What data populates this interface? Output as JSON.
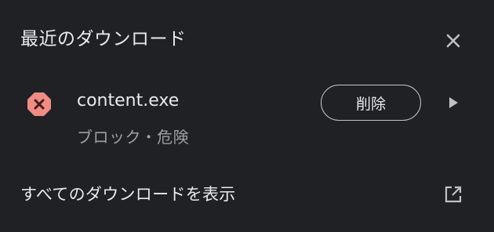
{
  "header": {
    "title": "最近のダウンロード",
    "close_icon": "close-icon"
  },
  "download": {
    "file_name": "content.exe",
    "status": "ブロック・危険",
    "status_icon": "danger-x-icon",
    "status_color": "#f28b82",
    "delete_label": "削除",
    "more_icon": "play-arrow-icon"
  },
  "footer": {
    "show_all_label": "すべてのダウンロードを表示",
    "open_icon": "open-in-new-icon"
  },
  "colors": {
    "background": "#202124",
    "text_primary": "#e8eaed",
    "text_secondary": "#9aa0a6",
    "danger": "#f28b82"
  }
}
